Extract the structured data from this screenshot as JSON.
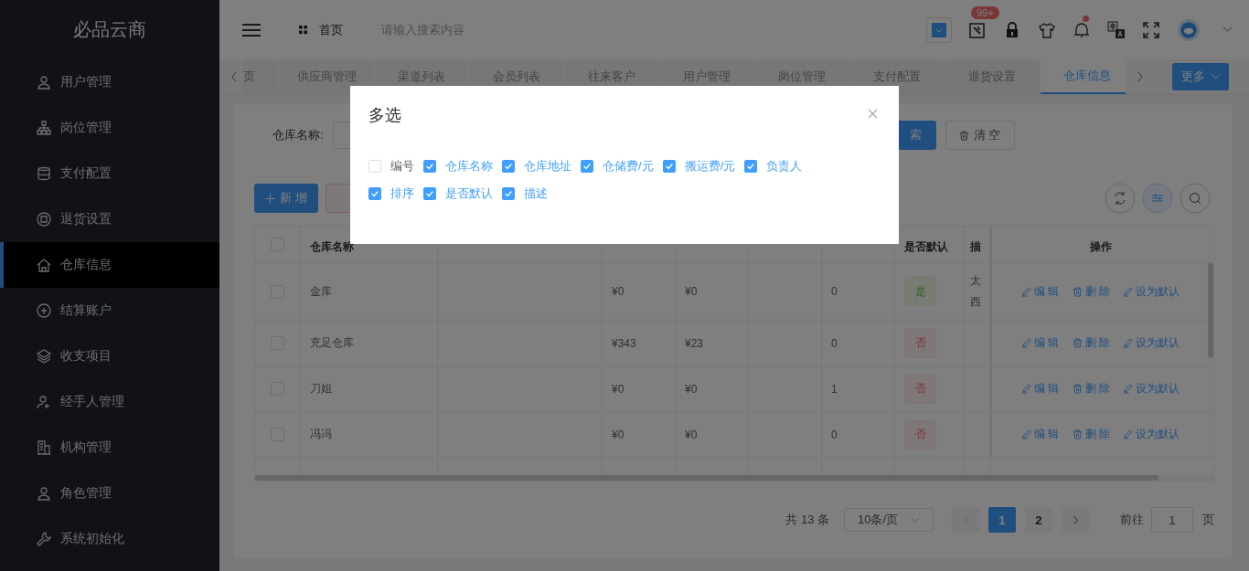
{
  "sidebar": {
    "logo": "必品云商",
    "items": [
      {
        "label": "用户管理",
        "selected": false
      },
      {
        "label": "岗位管理",
        "selected": false
      },
      {
        "label": "支付配置",
        "selected": false
      },
      {
        "label": "退货设置",
        "selected": false
      },
      {
        "label": "仓库信息",
        "selected": true
      },
      {
        "label": "结算账户",
        "selected": false
      },
      {
        "label": "收支项目",
        "selected": false
      },
      {
        "label": "经手人管理",
        "selected": false
      },
      {
        "label": "机构管理",
        "selected": false
      },
      {
        "label": "角色管理",
        "selected": false
      },
      {
        "label": "系统初始化",
        "selected": false
      }
    ]
  },
  "header": {
    "breadcrumb": "首页",
    "search": {
      "placeholder": "请输入搜索内容"
    },
    "badge": "99+"
  },
  "tabs": {
    "items": [
      {
        "label": "页",
        "selected": false
      },
      {
        "label": "供应商管理",
        "selected": false
      },
      {
        "label": "渠道列表",
        "selected": false
      },
      {
        "label": "会员列表",
        "selected": false
      },
      {
        "label": "往来客户",
        "selected": false
      },
      {
        "label": "用户管理",
        "selected": false
      },
      {
        "label": "岗位管理",
        "selected": false
      },
      {
        "label": "支付配置",
        "selected": false
      },
      {
        "label": "退货设置",
        "selected": false
      },
      {
        "label": "仓库信息",
        "selected": true
      }
    ],
    "more": "更多"
  },
  "filter": {
    "label": "仓库名称:",
    "search_button": "索",
    "clear_button": "清 空"
  },
  "toolbar": {
    "add_button": "新 增"
  },
  "table": {
    "all_selected": false,
    "columns": [
      "仓库名称",
      "是否默认",
      "描",
      "操作"
    ],
    "rows": [
      {
        "selected": false,
        "name": "金库",
        "storage_fee": "¥0",
        "handling_fee": "¥0",
        "sort": "0",
        "default": {
          "label": "是",
          "on": true
        },
        "description": [
          "太",
          "西"
        ],
        "actions": [
          "编 辑",
          "删 除",
          "设为默认"
        ]
      },
      {
        "selected": false,
        "name": "充足仓库",
        "storage_fee": "¥343",
        "handling_fee": "¥23",
        "sort": "0",
        "default": {
          "label": "否",
          "on": false
        },
        "actions": [
          "编 辑",
          "删 除",
          "设为默认"
        ]
      },
      {
        "selected": false,
        "name": "刀姐",
        "storage_fee": "¥0",
        "handling_fee": "¥0",
        "sort": "1",
        "default": {
          "label": "否",
          "on": false
        },
        "actions": [
          "编 辑",
          "删 除",
          "设为默认"
        ]
      },
      {
        "selected": false,
        "name": "冯冯",
        "storage_fee": "¥0",
        "handling_fee": "¥0",
        "sort": "0",
        "default": {
          "label": "否",
          "on": false
        },
        "actions": [
          "编 辑",
          "删 除",
          "设为默认"
        ]
      }
    ]
  },
  "pagination": {
    "total": "共 13 条",
    "page_size": "10条/页",
    "pages": [
      {
        "label": "1",
        "selected": true
      },
      {
        "label": "2",
        "selected": false
      }
    ],
    "goto_label": "前往",
    "goto_value": "1",
    "goto_suffix": "页"
  },
  "dialog": {
    "title": "多选",
    "options": [
      {
        "label": "编号",
        "checked": false
      },
      {
        "label": "仓库名称",
        "checked": true
      },
      {
        "label": "仓库地址",
        "checked": true
      },
      {
        "label": "仓储费/元",
        "checked": true
      },
      {
        "label": "搬运费/元",
        "checked": true
      },
      {
        "label": "负责人",
        "checked": true
      },
      {
        "label": "排序",
        "checked": true
      },
      {
        "label": "是否默认",
        "checked": true
      },
      {
        "label": "描述",
        "checked": true
      }
    ]
  }
}
